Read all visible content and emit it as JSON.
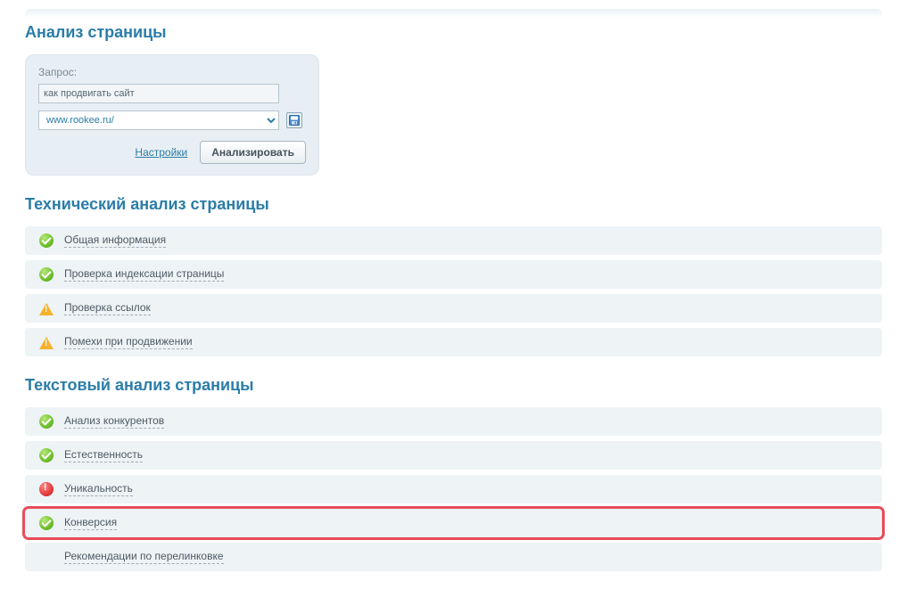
{
  "page_title": "Анализ страницы",
  "query_panel": {
    "label": "Запрос:",
    "query_value": "как продвигать сайт",
    "url_value": "www.rookee.ru/",
    "settings_link": "Настройки",
    "analyze_button": "Анализировать"
  },
  "sections": {
    "technical": {
      "title": "Технический анализ страницы",
      "items": [
        {
          "status": "ok",
          "label": "Общая информация"
        },
        {
          "status": "ok",
          "label": "Проверка индексации страницы"
        },
        {
          "status": "warn",
          "label": "Проверка ссылок"
        },
        {
          "status": "warn",
          "label": "Помехи при продвижении"
        }
      ]
    },
    "textual": {
      "title": "Текстовый анализ страницы",
      "items": [
        {
          "status": "ok",
          "label": "Анализ конкурентов"
        },
        {
          "status": "ok",
          "label": "Естественность"
        },
        {
          "status": "error",
          "label": "Уникальность"
        },
        {
          "status": "ok",
          "label": "Конверсия",
          "highlighted": true
        },
        {
          "status": "none",
          "label": "Рекомендации по перелинковке"
        }
      ]
    }
  }
}
